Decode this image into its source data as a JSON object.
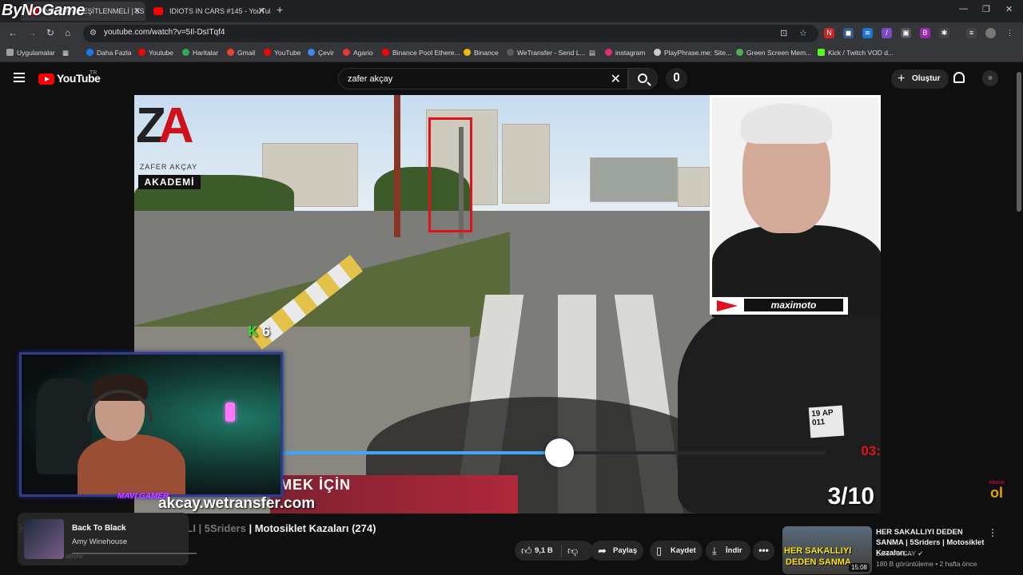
{
  "browser": {
    "brand_overlay": "ByNoGame",
    "tabs": [
      {
        "title": "NERSANLI EŞİTLENMELİ | 5S"
      },
      {
        "title": "IDIOTS IN CARS #145 - YouTub"
      }
    ],
    "url": "youtube.com/watch?v=5Il-DsITqf4",
    "bookmarks": [
      {
        "label": "Uygulamalar",
        "color": "#9aa0a6"
      },
      {
        "label": "Daha Fazla",
        "color": "#1877f2"
      },
      {
        "label": "Youtube",
        "color": "#ff0000"
      },
      {
        "label": "Haritalar",
        "color": "#34a853"
      },
      {
        "label": "Gmail",
        "color": "#ea4335"
      },
      {
        "label": "YouTube",
        "color": "#ff0000"
      },
      {
        "label": "Çevir",
        "color": "#4285f4"
      },
      {
        "label": "Agario",
        "color": "#e53935"
      },
      {
        "label": "Binance Pool Ethere...",
        "color": "#ff0000"
      },
      {
        "label": "Binance",
        "color": "#f0b90b"
      },
      {
        "label": "WeTransfer - Send L...",
        "color": "#5b5b5b"
      },
      {
        "label": "instagram",
        "color": "#e1306c"
      },
      {
        "label": "PlayPhrase.me: Site...",
        "color": "#cccccc"
      },
      {
        "label": "Green Screen Mem...",
        "color": "#4caf50"
      },
      {
        "label": "Kick / Twitch VOD d...",
        "color": "#53fc18"
      }
    ]
  },
  "youtube": {
    "logo": "YouTube",
    "country": "TR",
    "search_query": "zafer akçay",
    "create_label": "Oluştur"
  },
  "video": {
    "logo_name": "ZAFER AKÇAY",
    "logo_academy": "AKADEMİ",
    "k_count": "6",
    "brand_sponsor": "maximoto",
    "counter": "3/10",
    "timer": "03:",
    "banner_line1": "MEK İÇİN",
    "banner_line2": "akcay.wetransfer.com",
    "plate": "19 AP 011",
    "progress": 0.51
  },
  "stream": {
    "tag": "MAVI GAMER"
  },
  "watch": {
    "title_prefix": "H",
    "title_dim": "LI | 5Sriders",
    "title_main": " | Motosiklet Kazaları (274)",
    "likes": "9,1 B",
    "share": "Paylaş",
    "save": "Kaydet",
    "download": "İndir"
  },
  "miniplayer": {
    "title": "Back To Black",
    "artist": "Amy Winehouse",
    "ghost_channel": "abone"
  },
  "recommended": {
    "title": "HER SAKALLIYI DEDEN SANMA | 5Sriders | Motosiklet Kazaları...",
    "channel": "Zafer AKCAY",
    "meta": "180 B görüntüleme • 2 hafta önce",
    "duration": "15:08",
    "thumb_line1": "HER SAKALLIYI",
    "thumb_line2": "DEDEN SANMA"
  },
  "abone_badge": {
    "top": "Abone",
    "num": "ol"
  }
}
